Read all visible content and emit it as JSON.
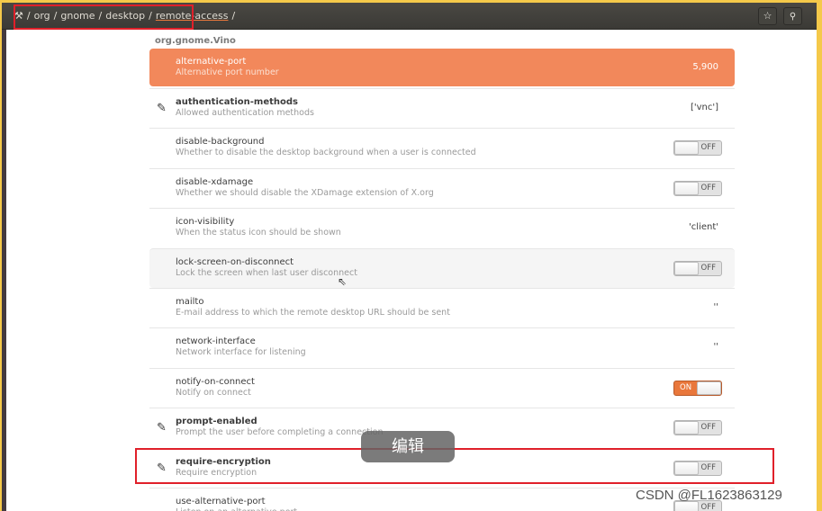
{
  "breadcrumb": {
    "root_icon": "dconf-icon",
    "items": [
      "/",
      "org",
      "/",
      "gnome",
      "/",
      "desktop",
      "/",
      "remote-access",
      "/"
    ]
  },
  "header_buttons": {
    "bookmark": "☆",
    "search": "🔍"
  },
  "schema": "org.gnome.Vino",
  "rows": [
    {
      "name": "alternative-port",
      "desc": "Alternative port number",
      "value": "5,900",
      "type": "value",
      "selected": true
    },
    {
      "name": "authentication-methods",
      "desc": "Allowed authentication methods",
      "value": "['vnc']",
      "type": "value",
      "modified": true
    },
    {
      "name": "disable-background",
      "desc": "Whether to disable the desktop background when a user is connected",
      "value": "OFF",
      "type": "switch"
    },
    {
      "name": "disable-xdamage",
      "desc": "Whether we should disable the XDamage extension of X.org",
      "value": "OFF",
      "type": "switch"
    },
    {
      "name": "icon-visibility",
      "desc": "When the status icon should be shown",
      "value": "'client'",
      "type": "value"
    },
    {
      "name": "lock-screen-on-disconnect",
      "desc": "Lock the screen when last user disconnect",
      "value": "OFF",
      "type": "switch",
      "hover": true
    },
    {
      "name": "mailto",
      "desc": "E-mail address to which the remote desktop URL should be sent",
      "value": "''",
      "type": "value"
    },
    {
      "name": "network-interface",
      "desc": "Network interface for listening",
      "value": "''",
      "type": "value"
    },
    {
      "name": "notify-on-connect",
      "desc": "Notify on connect",
      "value": "ON",
      "type": "switch"
    },
    {
      "name": "prompt-enabled",
      "desc": "Prompt the user before completing a connection",
      "value": "OFF",
      "type": "switch",
      "modified": true
    },
    {
      "name": "require-encryption",
      "desc": "Require encryption",
      "value": "OFF",
      "type": "switch",
      "modified": true
    },
    {
      "name": "use-alternative-port",
      "desc": "Listen on an alternative port",
      "value": "OFF",
      "type": "switch"
    }
  ],
  "tooltip": "编辑",
  "watermark": "CSDN @FL1623863129",
  "colors": {
    "accent": "#e9773b",
    "selected": "#f2885b",
    "highlight": "#e0202a",
    "frame": "#f5c94a"
  }
}
